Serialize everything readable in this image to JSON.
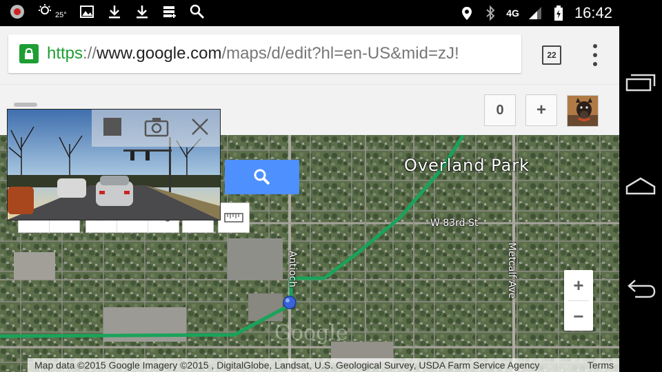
{
  "status_bar": {
    "temperature": "25°",
    "network": "4G",
    "time": "16:42"
  },
  "browser": {
    "url": {
      "scheme": "https",
      "separator": "://",
      "host": "www.google.com",
      "path": "/maps/d/edit?hl=en-US&mid=zJ!"
    },
    "tab_count": "22"
  },
  "map_toolbar": {
    "count_button": "0",
    "add_button": "+"
  },
  "map": {
    "place_label": "Overland Park",
    "street_labels": {
      "w83rd": "W 83rd St",
      "antioch": "Antioch",
      "metcalf": "Metcalf Ave"
    },
    "watermark": "Google",
    "zoom_in": "+",
    "zoom_out": "−",
    "attribution": "Map data ©2015 Google Imagery ©2015 , DigitalGlobe, Landsat, U.S. Geological Survey, USDA Farm Service Agency",
    "terms": "Terms",
    "route_color": "#1aa35a",
    "marker_color": "#3a63d6",
    "search_color": "#4d90fe"
  }
}
